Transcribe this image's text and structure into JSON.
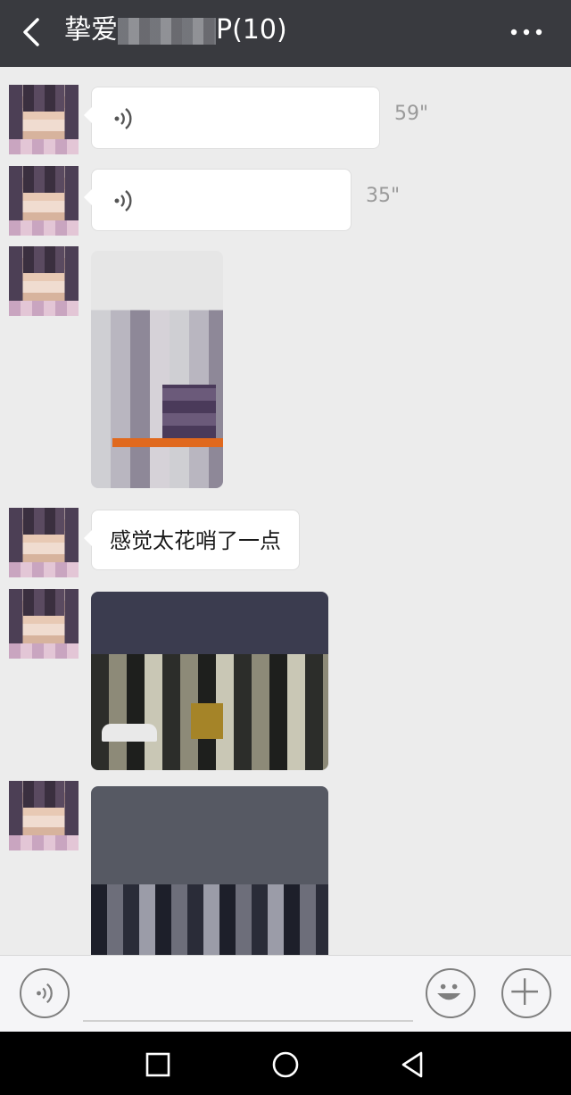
{
  "header": {
    "title_prefix": "挚爱",
    "title_suffix": "P(10)",
    "back_icon": "chevron-left-icon",
    "more_icon": "more-dots-icon"
  },
  "messages": [
    {
      "type": "voice",
      "duration": "59\""
    },
    {
      "type": "voice",
      "duration": "35\""
    },
    {
      "type": "image"
    },
    {
      "type": "text",
      "text": "感觉太花哨了一点"
    },
    {
      "type": "image"
    },
    {
      "type": "image"
    }
  ],
  "input_bar": {
    "voice_icon": "voice-input-icon",
    "emoji_icon": "emoji-icon",
    "plus_icon": "plus-icon",
    "placeholder": ""
  },
  "system_nav": {
    "recent_icon": "recent-apps-icon",
    "home_icon": "home-icon",
    "back_icon": "back-triangle-icon"
  },
  "colors": {
    "header_bg": "#393a3f",
    "chat_bg": "#ececec",
    "bubble_bg": "#ffffff",
    "accent_orange": "#e0691e"
  }
}
